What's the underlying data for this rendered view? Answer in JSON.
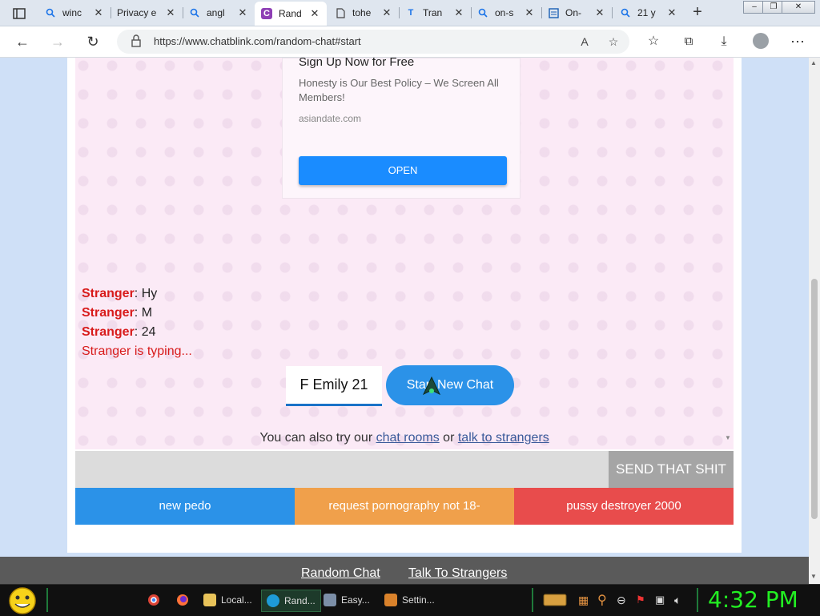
{
  "tabs": [
    {
      "label": "winc",
      "icon": "search-icon"
    },
    {
      "label": "Privacy e",
      "icon": ""
    },
    {
      "label": "angl",
      "icon": "search-icon"
    },
    {
      "label": "Rand",
      "icon": "chatblink-icon",
      "active": true
    },
    {
      "label": "tohe",
      "icon": "page-icon"
    },
    {
      "label": "Tran",
      "icon": "translate-icon"
    },
    {
      "label": "on-s",
      "icon": "search-icon"
    },
    {
      "label": "On-",
      "icon": "document-icon"
    },
    {
      "label": "21 y",
      "icon": "search-icon"
    }
  ],
  "address": {
    "url": "https://www.chatblink.com/random-chat#start"
  },
  "ad": {
    "title": "Sign Up Now for Free",
    "text": "Honesty is Our Best Policy – We Screen All Members!",
    "domain": "asiandate.com",
    "button": "OPEN"
  },
  "messages": [
    {
      "who": "Stranger",
      "text": ": Hy"
    },
    {
      "who": "Stranger",
      "text": ": M"
    },
    {
      "who": "Stranger",
      "text": ": 24"
    }
  ],
  "typing": "Stranger is typing...",
  "name_field": "F Emily 21",
  "start_button": "Start New Chat",
  "also_try": {
    "prefix": "You can also try our ",
    "link1": "chat rooms",
    "middle": " or ",
    "link2": "talk to strangers"
  },
  "send_button": "SEND THAT SHIT",
  "quick_buttons": [
    {
      "label": "new pedo",
      "color": "#2b92e8"
    },
    {
      "label": "request pornography not 18-",
      "color": "#f0a04b"
    },
    {
      "label": "pussy destroyer 2000",
      "color": "#e84c4c"
    }
  ],
  "footer": {
    "link1": "Random Chat",
    "link2": "Talk To Strangers"
  },
  "taskbar": {
    "items": [
      "Local...",
      "Rand...",
      "Easy...",
      "Settin..."
    ],
    "clock": "4:32 PM"
  }
}
